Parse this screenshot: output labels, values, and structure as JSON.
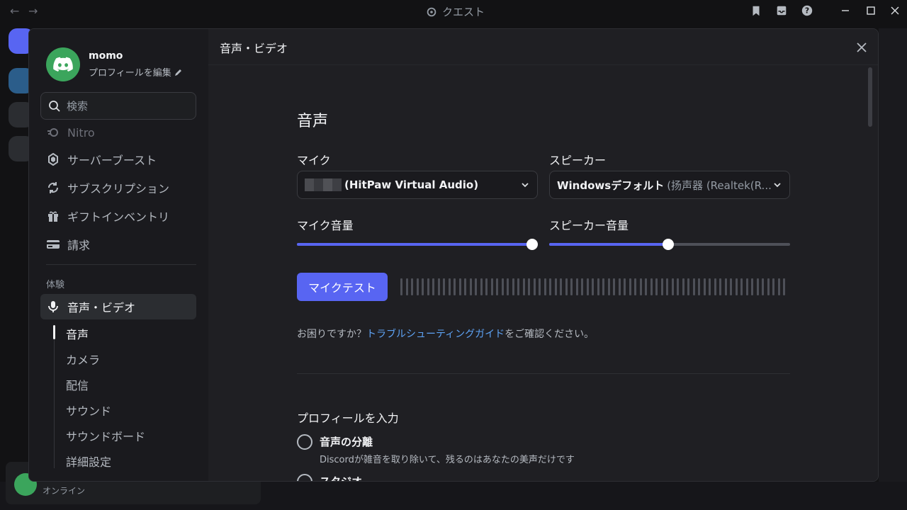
{
  "titlebar": {
    "title": "クエスト",
    "back_glyph": "←",
    "forward_glyph": "→"
  },
  "user": {
    "name": "momo",
    "edit_profile": "プロフィールを編集",
    "status": "オンライン"
  },
  "search": {
    "placeholder": "検索"
  },
  "sidebar": {
    "items": [
      {
        "label": "Nitro",
        "icon": "nitro-icon"
      },
      {
        "label": "サーバーブースト",
        "icon": "boost-icon"
      },
      {
        "label": "サブスクリプション",
        "icon": "subscription-icon"
      },
      {
        "label": "ギフトインベントリ",
        "icon": "gift-icon"
      },
      {
        "label": "請求",
        "icon": "card-icon"
      }
    ],
    "section_label": "体験",
    "active_item": {
      "label": "音声・ビデオ",
      "icon": "microphone-icon"
    },
    "sub_items": [
      "音声",
      "カメラ",
      "配信",
      "サウンド",
      "サウンドボード",
      "詳細設定"
    ]
  },
  "main": {
    "header": "音声・ビデオ",
    "voice_title": "音声",
    "mic_label": "マイク",
    "mic_value": "(HitPaw Virtual Audio)",
    "speaker_label": "スピーカー",
    "speaker_value_bold": "Windowsデフォルト",
    "speaker_value_muted": "(扬声器 (Realtek(R...",
    "mic_volume_label": "マイク音量",
    "mic_volume": 1.0,
    "speaker_volume_label": "スピーカー音量",
    "speaker_volume": 0.5,
    "mic_test_label": "マイクテスト",
    "help_prefix": "お困りですか？",
    "help_link": "トラブルシューティングガイド",
    "help_suffix": "をご確認ください。",
    "profile_title": "プロフィールを入力",
    "option1_title": "音声の分離",
    "option1_desc": "Discordが雑音を取り除いて、残るのはあなたの美声だけです",
    "option2_title": "スタジオ"
  },
  "colors": {
    "accent": "#5865f2",
    "link": "#5ea3f5",
    "online": "#3ba55c"
  }
}
